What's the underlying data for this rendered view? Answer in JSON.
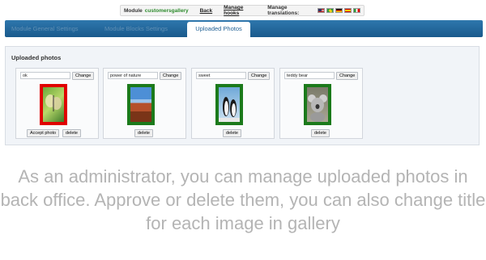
{
  "module_bar": {
    "label": "Module",
    "module_name": "customersgallery",
    "back": "Back",
    "manage_hooks": "Manage hooks",
    "manage_translations": "Manage translations:",
    "flags": [
      "us",
      "br",
      "de",
      "es",
      "it"
    ]
  },
  "tabs": [
    {
      "label": "Module General Settings",
      "active": false
    },
    {
      "label": "Module Blocks Settings",
      "active": false
    },
    {
      "label": "Uploaded Photos",
      "active": true
    }
  ],
  "panel": {
    "title": "Uploaded photos",
    "photos": [
      {
        "title": "ok",
        "change": "Change",
        "accept": "Accept photo",
        "delete": "delete",
        "status": "pending",
        "status_color": "#e00000",
        "image": "butterfly-icon"
      },
      {
        "title": "power of nature",
        "change": "Change",
        "delete": "delete",
        "status": "approved",
        "status_color": "#1b7a1b",
        "image": "desert-rock-icon"
      },
      {
        "title": "sweet",
        "change": "Change",
        "delete": "delete",
        "status": "approved",
        "status_color": "#1b7a1b",
        "image": "penguins-icon"
      },
      {
        "title": "teddy bear",
        "change": "Change",
        "delete": "delete",
        "status": "approved",
        "status_color": "#1b7a1b",
        "image": "koala-icon"
      }
    ]
  },
  "caption": "As an administrator, you can manage uploaded photos in back office. Approve or delete them, you can also change title for each image in gallery"
}
